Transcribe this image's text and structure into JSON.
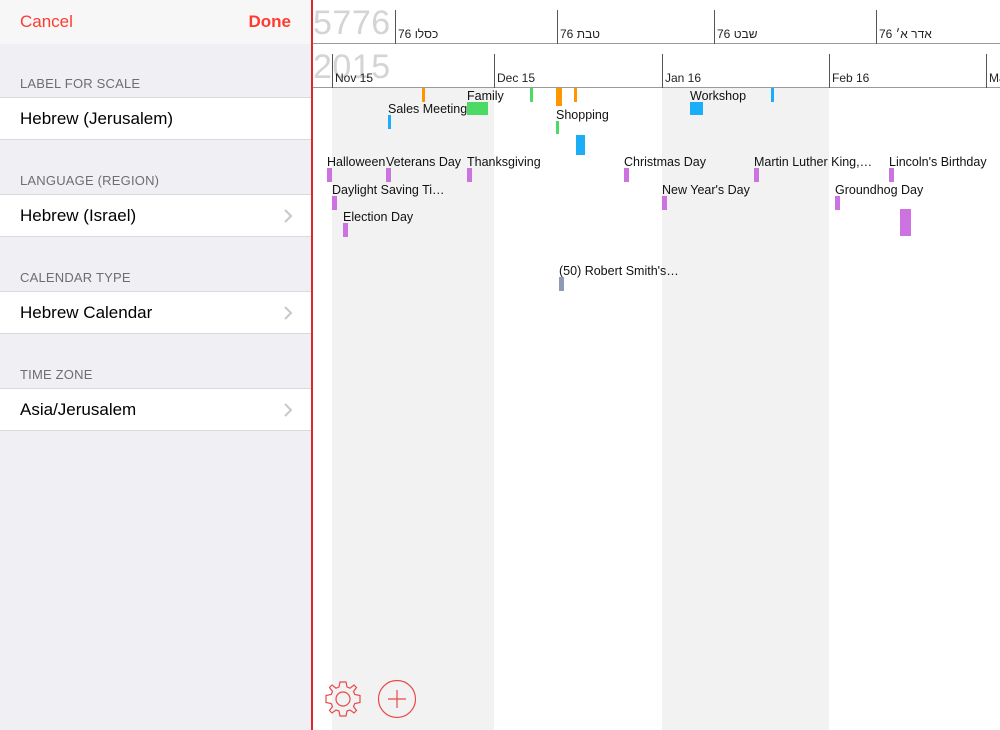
{
  "nav": {
    "cancel": "Cancel",
    "done": "Done"
  },
  "sections": [
    {
      "header": "LABEL FOR SCALE",
      "value": "Hebrew (Jerusalem)",
      "chevron": false
    },
    {
      "header": "LANGUAGE (REGION)",
      "value": "Hebrew (Israel)",
      "chevron": true
    },
    {
      "header": "CALENDAR TYPE",
      "value": "Hebrew Calendar",
      "chevron": true
    },
    {
      "header": "TIME ZONE",
      "value": "Asia/Jerusalem",
      "chevron": true
    }
  ],
  "timeline": {
    "hebrew_year": "5776",
    "gregorian_year": "2015",
    "hebrew_months": [
      "כסלו 76",
      "טבת 76",
      "שבט 76",
      "אדר א׳ 76"
    ],
    "gregorian_months": [
      "Nov 15",
      "Dec 15",
      "Jan 16",
      "Feb 16",
      "Ma"
    ],
    "events": [
      {
        "label": "Sales Meeting"
      },
      {
        "label": "Family"
      },
      {
        "label": "Workshop"
      },
      {
        "label": "Shopping"
      },
      {
        "label": "Halloween"
      },
      {
        "label": "Veterans Day"
      },
      {
        "label": "Thanksgiving"
      },
      {
        "label": "Christmas Day"
      },
      {
        "label": "Martin Luther King,…"
      },
      {
        "label": "Lincoln's Birthday"
      },
      {
        "label": "Daylight Saving Ti…"
      },
      {
        "label": "New Year's Day"
      },
      {
        "label": "Groundhog Day"
      },
      {
        "label": "Election Day"
      },
      {
        "label": "(50) Robert Smith's…"
      }
    ]
  },
  "tools": {
    "settings_icon": "gear-icon",
    "add_icon": "plus-circle-icon"
  },
  "colors": {
    "accent": "#ff3b30",
    "divider": "#e0262d",
    "orange": "#ff9500",
    "green": "#4cd964",
    "blue": "#1badf8",
    "purple": "#cc73e1",
    "slate": "#8e9bb5"
  }
}
